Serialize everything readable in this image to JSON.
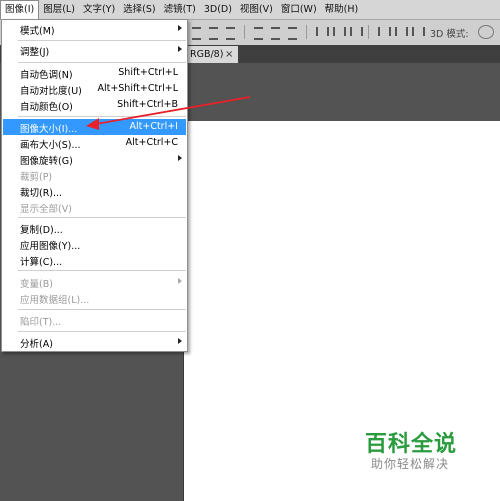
{
  "menubar": {
    "items": [
      {
        "label": "图像(I)"
      },
      {
        "label": "图层(L)"
      },
      {
        "label": "文字(Y)"
      },
      {
        "label": "选择(S)"
      },
      {
        "label": "滤镜(T)"
      },
      {
        "label": "3D(D)"
      },
      {
        "label": "视图(V)"
      },
      {
        "label": "窗口(W)"
      },
      {
        "label": "帮助(H)"
      }
    ]
  },
  "options": {
    "mode3d_label": "3D 模式:"
  },
  "document": {
    "tab_label": "RGB/8)",
    "close_glyph": "×"
  },
  "image_menu": {
    "items": [
      {
        "label": "模式(M)",
        "shortcut": "",
        "submenu": true,
        "disabled": false
      },
      {
        "label": "调整(J)",
        "shortcut": "",
        "submenu": true,
        "disabled": false
      },
      {
        "label": "自动色调(N)",
        "shortcut": "Shift+Ctrl+L",
        "submenu": false,
        "disabled": false
      },
      {
        "label": "自动对比度(U)",
        "shortcut": "Alt+Shift+Ctrl+L",
        "submenu": false,
        "disabled": false
      },
      {
        "label": "自动颜色(O)",
        "shortcut": "Shift+Ctrl+B",
        "submenu": false,
        "disabled": false
      },
      {
        "label": "图像大小(I)...",
        "shortcut": "Alt+Ctrl+I",
        "submenu": false,
        "disabled": false,
        "highlighted": true
      },
      {
        "label": "画布大小(S)...",
        "shortcut": "Alt+Ctrl+C",
        "submenu": false,
        "disabled": false
      },
      {
        "label": "图像旋转(G)",
        "shortcut": "",
        "submenu": true,
        "disabled": false
      },
      {
        "label": "裁剪(P)",
        "shortcut": "",
        "submenu": false,
        "disabled": true
      },
      {
        "label": "裁切(R)...",
        "shortcut": "",
        "submenu": false,
        "disabled": false
      },
      {
        "label": "显示全部(V)",
        "shortcut": "",
        "submenu": false,
        "disabled": true
      },
      {
        "label": "复制(D)...",
        "shortcut": "",
        "submenu": false,
        "disabled": false
      },
      {
        "label": "应用图像(Y)...",
        "shortcut": "",
        "submenu": false,
        "disabled": false
      },
      {
        "label": "计算(C)...",
        "shortcut": "",
        "submenu": false,
        "disabled": false
      },
      {
        "label": "变量(B)",
        "shortcut": "",
        "submenu": true,
        "disabled": true
      },
      {
        "label": "应用数据组(L)...",
        "shortcut": "",
        "submenu": false,
        "disabled": true
      },
      {
        "label": "陷印(T)...",
        "shortcut": "",
        "submenu": false,
        "disabled": true
      },
      {
        "label": "分析(A)",
        "shortcut": "",
        "submenu": true,
        "disabled": false
      }
    ]
  },
  "watermark": {
    "title": "百科全说",
    "subtitle": "助你轻松解决"
  },
  "colors": {
    "highlight": "#3399ff",
    "annotation_arrow": "#e8202a",
    "watermark_green": "#2a9b3e"
  }
}
